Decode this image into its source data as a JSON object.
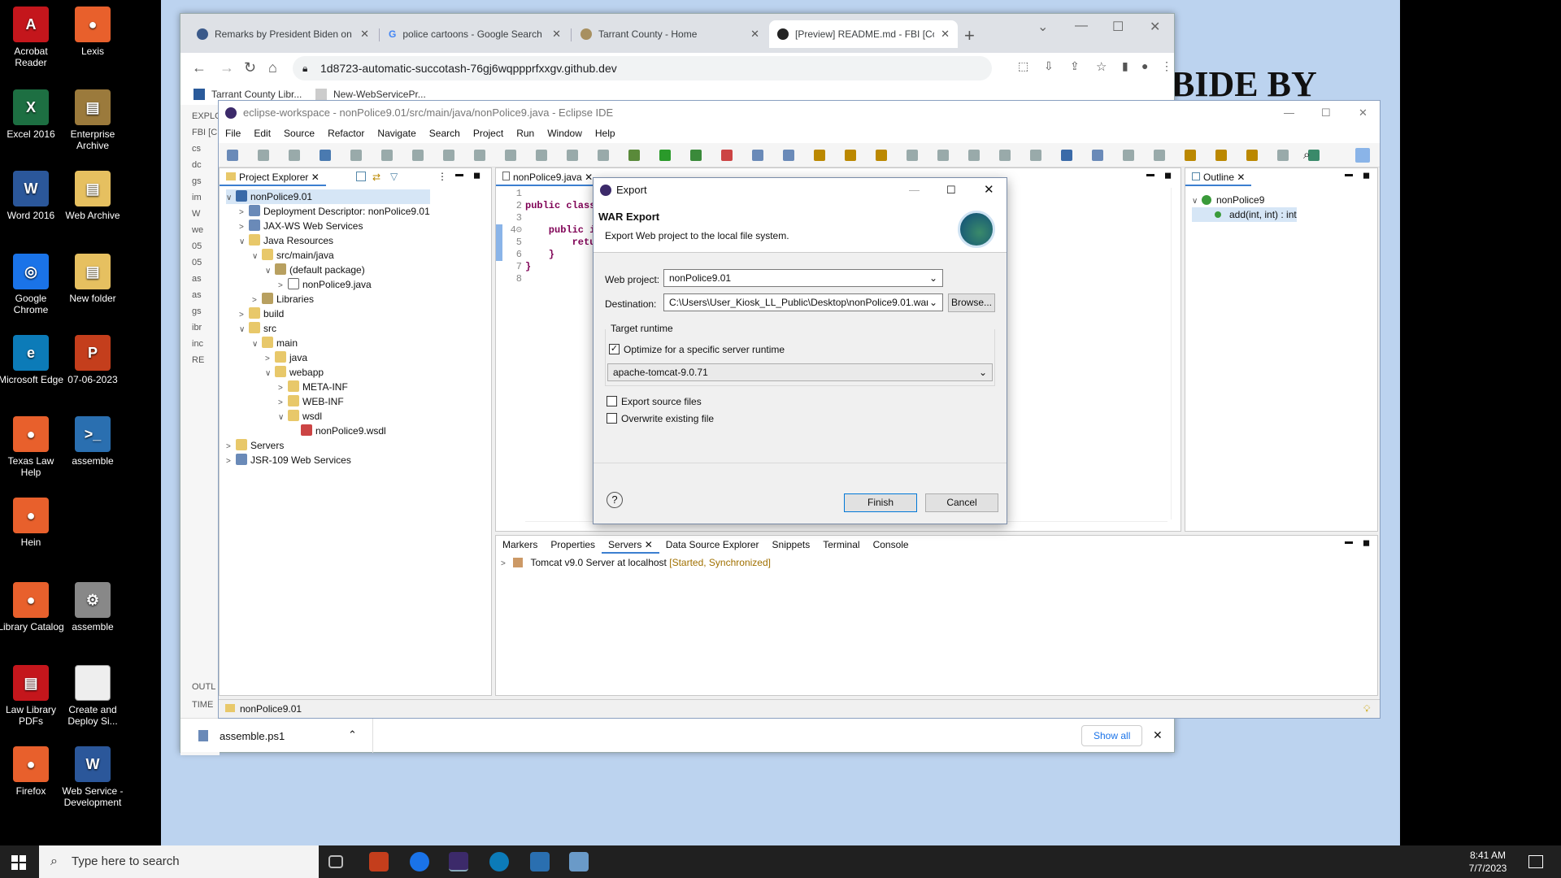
{
  "desktop": {
    "icons": [
      {
        "label": "Acrobat Reader",
        "color": "#c4161c",
        "glyph": "A"
      },
      {
        "label": "Lexis",
        "color": "#e8602c",
        "glyph": "●"
      },
      {
        "label": "Excel 2016",
        "color": "#1d6f42",
        "glyph": "X"
      },
      {
        "label": "Enterprise Archive",
        "color": "#9b7a3c",
        "glyph": "▤"
      },
      {
        "label": "Word 2016",
        "color": "#2b579a",
        "glyph": "W"
      },
      {
        "label": "Web Archive",
        "color": "#e6c060",
        "glyph": "▤"
      },
      {
        "label": "Google Chrome",
        "color": "#1a73e8",
        "glyph": "◎"
      },
      {
        "label": "New folder",
        "color": "#e6c060",
        "glyph": "▤"
      },
      {
        "label": "Microsoft Edge",
        "color": "#0c7bb8",
        "glyph": "e"
      },
      {
        "label": "07-06-2023",
        "color": "#c43e1c",
        "glyph": "P"
      },
      {
        "label": "Texas Law Help",
        "color": "#e8602c",
        "glyph": "●"
      },
      {
        "label": "assemble",
        "color": "#2a6fb0",
        "glyph": ">_"
      },
      {
        "label": "Hein",
        "color": "#e8602c",
        "glyph": "●"
      },
      {
        "label": "Library Catalog",
        "color": "#e8602c",
        "glyph": "●"
      },
      {
        "label": "assemble",
        "color": "#888888",
        "glyph": "⚙"
      },
      {
        "label": "Law Library PDFs",
        "color": "#c4161c",
        "glyph": "▤"
      },
      {
        "label": "Create and Deploy Si...",
        "color": "#eeeeee",
        "glyph": ""
      },
      {
        "label": "Firefox",
        "color": "#e8602c",
        "glyph": "●"
      },
      {
        "label": "Web Service - Development",
        "color": "#2b579a",
        "glyph": "W"
      }
    ],
    "background_text": "BIDE BY"
  },
  "chrome": {
    "tabs": [
      {
        "title": "Remarks by President Biden on th",
        "icon": "whitehouse-icon"
      },
      {
        "title": "police cartoons - Google Search",
        "icon": "google-icon"
      },
      {
        "title": "Tarrant County - Home",
        "icon": "seal-icon"
      },
      {
        "title": "[Preview] README.md - FBI [Co",
        "icon": "github-icon"
      }
    ],
    "url": "1d8723-automatic-succotash-76gj6wqppprfxxgv.github.dev",
    "bookmarks": [
      "Tarrant County Libr...",
      "New-WebServicePr..."
    ],
    "github_sidebar": [
      "EXPLO",
      "FBI [C",
      "cs",
      "dc",
      "gs",
      "im",
      "W",
      "we",
      "05",
      "05",
      "as",
      "as",
      "gs",
      "ibr",
      "inc",
      "RE",
      "OUTL",
      "TIME"
    ],
    "download": {
      "file": "assemble.ps1",
      "show_all": "Show all"
    }
  },
  "eclipse": {
    "title": "eclipse-workspace - nonPolice9.01/src/main/java/nonPolice9.java - Eclipse IDE",
    "menu": [
      "File",
      "Edit",
      "Source",
      "Refactor",
      "Navigate",
      "Search",
      "Project",
      "Run",
      "Window",
      "Help"
    ],
    "project_explorer": {
      "tab": "Project Explorer",
      "items": [
        {
          "label": "nonPolice9.01",
          "depth": 0,
          "exp": "∨",
          "icon": "project",
          "sel": true
        },
        {
          "label": "Deployment Descriptor: nonPolice9.01",
          "depth": 1,
          "exp": ">",
          "icon": "descriptor"
        },
        {
          "label": "JAX-WS Web Services",
          "depth": 1,
          "exp": ">",
          "icon": "service"
        },
        {
          "label": "Java Resources",
          "depth": 1,
          "exp": "∨",
          "icon": "folder"
        },
        {
          "label": "src/main/java",
          "depth": 2,
          "exp": "∨",
          "icon": "folder"
        },
        {
          "label": "(default package)",
          "depth": 3,
          "exp": "∨",
          "icon": "package"
        },
        {
          "label": "nonPolice9.java",
          "depth": 4,
          "exp": ">",
          "icon": "java"
        },
        {
          "label": "Libraries",
          "depth": 2,
          "exp": ">",
          "icon": "library"
        },
        {
          "label": "build",
          "depth": 1,
          "exp": ">",
          "icon": "folder"
        },
        {
          "label": "src",
          "depth": 1,
          "exp": "∨",
          "icon": "folder"
        },
        {
          "label": "main",
          "depth": 2,
          "exp": "∨",
          "icon": "folder"
        },
        {
          "label": "java",
          "depth": 3,
          "exp": ">",
          "icon": "folder"
        },
        {
          "label": "webapp",
          "depth": 3,
          "exp": "∨",
          "icon": "folder"
        },
        {
          "label": "META-INF",
          "depth": 4,
          "exp": ">",
          "icon": "folder"
        },
        {
          "label": "WEB-INF",
          "depth": 4,
          "exp": ">",
          "icon": "folder"
        },
        {
          "label": "wsdl",
          "depth": 4,
          "exp": "∨",
          "icon": "folder"
        },
        {
          "label": "nonPolice9.wsdl",
          "depth": 5,
          "exp": "",
          "icon": "wsdl"
        },
        {
          "label": "Servers",
          "depth": 0,
          "exp": ">",
          "icon": "folder"
        },
        {
          "label": "JSR-109 Web Services",
          "depth": 0,
          "exp": ">",
          "icon": "service"
        }
      ]
    },
    "editor": {
      "tab": "nonPolice9.java",
      "lines": [
        {
          "n": "1",
          "code": ""
        },
        {
          "n": "2",
          "code": "public class"
        },
        {
          "n": "3",
          "code": ""
        },
        {
          "n": "4⊝",
          "code": "    public i"
        },
        {
          "n": "5",
          "code": "        retu"
        },
        {
          "n": "6",
          "code": "    }"
        },
        {
          "n": "7",
          "code": "}"
        },
        {
          "n": "8",
          "code": ""
        }
      ]
    },
    "outline": {
      "tab": "Outline",
      "root": "nonPolice9",
      "method": "add(int, int) : int"
    },
    "bottom_tabs": [
      "Markers",
      "Properties",
      "Servers",
      "Data Source Explorer",
      "Snippets",
      "Terminal",
      "Console"
    ],
    "server": {
      "name": "Tomcat v9.0 Server at localhost",
      "state": "[Started, Synchronized]"
    },
    "status": "nonPolice9.01"
  },
  "dialog": {
    "title": "Export",
    "heading": "WAR Export",
    "description": "Export Web project to the local file system.",
    "web_project_label": "Web project:",
    "web_project_value": "nonPolice9.01",
    "destination_label": "Destination:",
    "destination_value": "C:\\Users\\User_Kiosk_LL_Public\\Desktop\\nonPolice9.01.war",
    "browse": "Browse...",
    "target_runtime": "Target runtime",
    "optimize_label": "Optimize for a specific server runtime",
    "optimize_checked": true,
    "runtime_value": "apache-tomcat-9.0.71",
    "export_source": "Export source files",
    "overwrite": "Overwrite existing file",
    "finish": "Finish",
    "cancel": "Cancel"
  },
  "taskbar": {
    "search_placeholder": "Type here to search",
    "time": "8:41 AM",
    "date": "7/7/2023"
  }
}
